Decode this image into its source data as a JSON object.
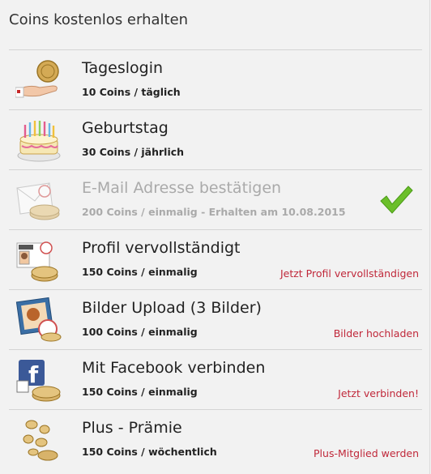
{
  "panel": {
    "title": "Coins kostenlos erhalten",
    "items": [
      {
        "title": "Tageslogin",
        "sub": "10 Coins / täglich",
        "action": "",
        "icon": "hand-coin-icon"
      },
      {
        "title": "Geburtstag",
        "sub": "30 Coins / jährlich",
        "action": "",
        "icon": "birthday-cake-icon"
      },
      {
        "title": "E-Mail Adresse bestätigen",
        "sub": "200 Coins / einmalig - Erhalten am 10.08.2015",
        "action": "",
        "icon": "email-coin-icon",
        "completed": true
      },
      {
        "title": "Profil vervollständigt",
        "sub": "150 Coins / einmalig",
        "action": "Jetzt Profil vervollständigen",
        "icon": "profile-card-icon"
      },
      {
        "title": "Bilder Upload (3 Bilder)",
        "sub": "100 Coins / einmalig",
        "action": "Bilder hochladen",
        "icon": "photo-upload-icon"
      },
      {
        "title": "Mit Facebook verbinden",
        "sub": "150 Coins / einmalig",
        "action": "Jetzt verbinden!",
        "icon": "facebook-icon"
      },
      {
        "title": "Plus - Prämie",
        "sub": "150 Coins / wöchentlich",
        "action": "Plus-Mitglied werden",
        "icon": "falling-coins-icon"
      }
    ]
  },
  "colors": {
    "accent_red": "#c0283a",
    "check_green": "#6bbf2a",
    "coin_gold": "#c9a24a"
  }
}
